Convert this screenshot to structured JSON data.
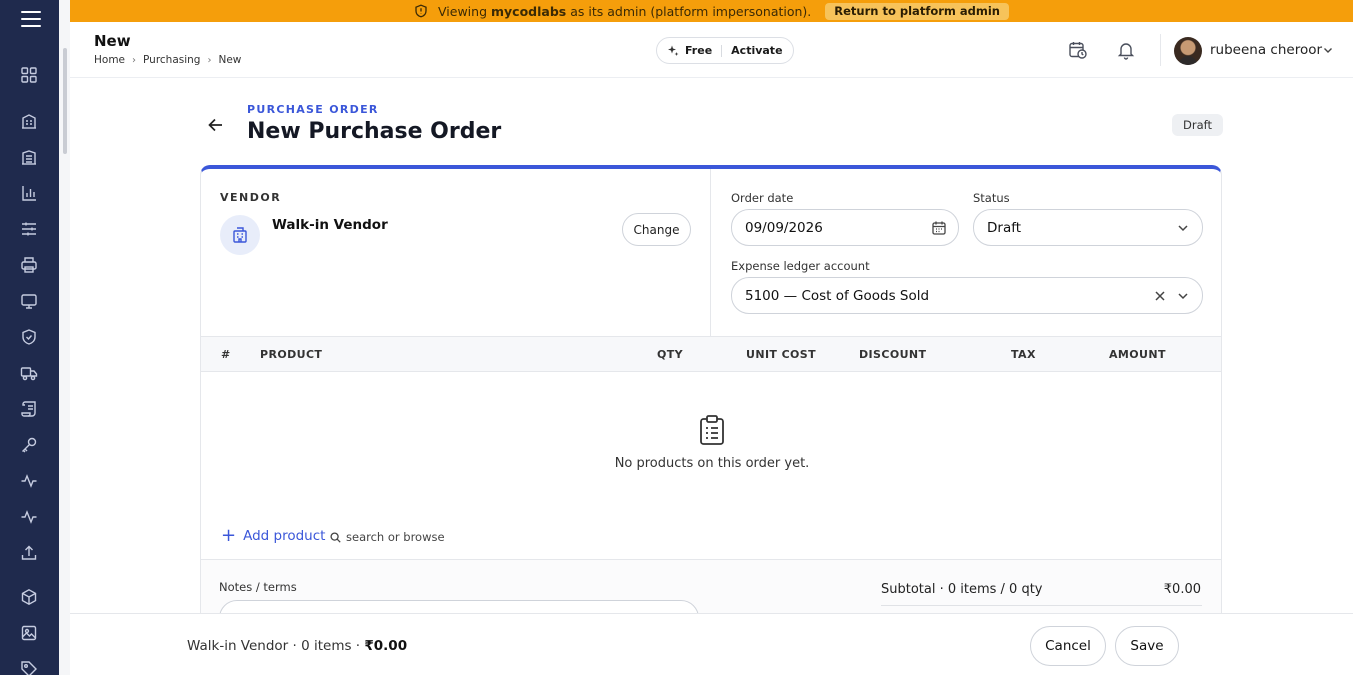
{
  "banner": {
    "text_before": "Viewing",
    "org_name": "mycodlabs",
    "text_after": "as its admin (platform impersonation).",
    "return_button": "Return to platform admin",
    "color": "#f59e0b"
  },
  "sidebar": {
    "color": "#1f2a4d",
    "items": [
      {
        "icon": "dashboard-grid-icon"
      },
      {
        "icon": "building-icon"
      },
      {
        "icon": "warehouse-icon"
      },
      {
        "icon": "bar-chart-icon"
      },
      {
        "icon": "sliders-icon"
      },
      {
        "icon": "printer-icon"
      },
      {
        "icon": "monitor-icon"
      },
      {
        "icon": "shield-check-icon"
      },
      {
        "icon": "truck-icon"
      },
      {
        "icon": "scroll-icon"
      },
      {
        "icon": "key-icon"
      },
      {
        "icon": "activity-icon"
      },
      {
        "icon": "pulse-icon"
      },
      {
        "icon": "upload-icon"
      },
      {
        "icon": "package-icon"
      },
      {
        "icon": "image-icon"
      },
      {
        "icon": "tag-icon"
      }
    ]
  },
  "header": {
    "title": "New",
    "breadcrumb": [
      "Home",
      "Purchasing",
      "New"
    ],
    "plan": {
      "label": "Free",
      "action": "Activate"
    },
    "user": {
      "name": "rubeena cheroor"
    }
  },
  "page": {
    "eyebrow": "PURCHASE ORDER",
    "title": "New Purchase Order",
    "status_badge": "Draft",
    "accent_color": "#3b57d9"
  },
  "vendor": {
    "section_label": "VENDOR",
    "name": "Walk-in Vendor",
    "change_button": "Change"
  },
  "form": {
    "order_date": {
      "label": "Order date",
      "value": "09/09/2026"
    },
    "status": {
      "label": "Status",
      "value": "Draft"
    },
    "expense_ledger": {
      "label": "Expense ledger account",
      "value": "5100 — Cost of Goods Sold"
    }
  },
  "table": {
    "columns": [
      "#",
      "PRODUCT",
      "QTY",
      "UNIT COST",
      "DISCOUNT",
      "TAX",
      "AMOUNT"
    ],
    "rows": [],
    "empty_message": "No products on this order yet."
  },
  "add_product": {
    "label": "Add product",
    "hint": "search or browse"
  },
  "notes": {
    "label": "Notes / terms",
    "value": ""
  },
  "totals": {
    "subtotal_label": "Subtotal · 0 items / 0 qty",
    "subtotal_value": "₹0.00"
  },
  "footer": {
    "summary_prefix": "Walk-in Vendor · 0 items · ",
    "summary_total": "₹0.00",
    "cancel": "Cancel",
    "save": "Save"
  }
}
